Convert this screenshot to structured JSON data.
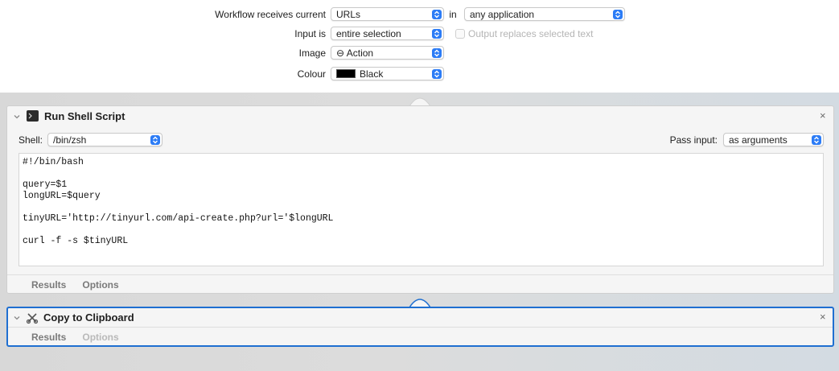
{
  "header": {
    "receives_label": "Workflow receives current",
    "receives_value": "URLs",
    "in_label": "in",
    "application_value": "any application",
    "input_label": "Input is",
    "input_value": "entire selection",
    "output_replaces_label": "Output replaces selected text",
    "image_label": "Image",
    "image_value": "⊖ Action",
    "colour_label": "Colour",
    "colour_value": "Black",
    "colour_swatch": "#000000"
  },
  "run_shell_script": {
    "title": "Run Shell Script",
    "shell_label": "Shell:",
    "shell_value": "/bin/zsh",
    "pass_input_label": "Pass input:",
    "pass_input_value": "as arguments",
    "script_lines": [
      "#!/bin/bash",
      "",
      "query=$1",
      "longURL=$query",
      "",
      "tinyURL='http://tinyurl.com/api-create.php?url='$longURL",
      "",
      "curl -f -s $tinyURL"
    ],
    "tab_results": "Results",
    "tab_options": "Options",
    "close": "×"
  },
  "copy_to_clipboard": {
    "title": "Copy to Clipboard",
    "tab_results": "Results",
    "tab_options": "Options",
    "close": "×"
  },
  "colors": {
    "accent": "#2c7cf6",
    "selection_border": "#1f6fd1"
  }
}
